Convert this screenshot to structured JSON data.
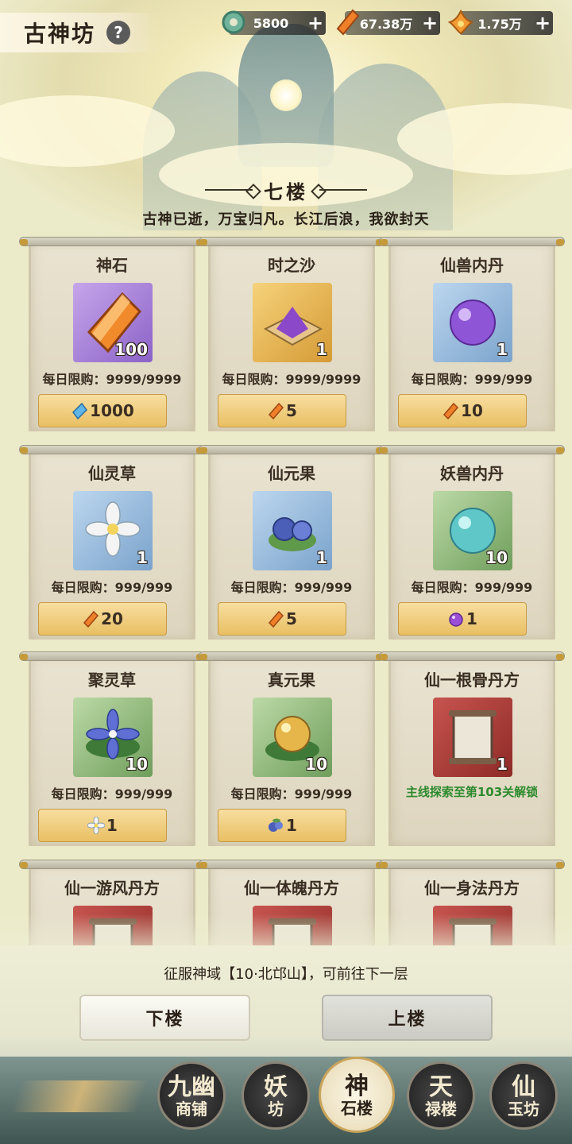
{
  "header": {
    "title": "古神坊",
    "help_icon": "question-mark-icon"
  },
  "resources": [
    {
      "icon": "jade-coin-icon",
      "value": "5800"
    },
    {
      "icon": "orange-crystal-icon",
      "value": "67.38万"
    },
    {
      "icon": "lotus-flame-icon",
      "value": "1.75万"
    }
  ],
  "floor": {
    "name": "七楼",
    "subtitle": "古神已逝，万宝归凡。长江后浪，我欲封天"
  },
  "items": [
    {
      "name": "神石",
      "count": "100",
      "limit": "每日限购：9999/9999",
      "price": "1000",
      "price_icon": "blue-crystal-icon",
      "bg": "purple"
    },
    {
      "name": "时之沙",
      "count": "1",
      "limit": "每日限购：9999/9999",
      "price": "5",
      "price_icon": "orange-crystal-icon",
      "bg": "gold"
    },
    {
      "name": "仙兽内丹",
      "count": "1",
      "limit": "每日限购：999/999",
      "price": "10",
      "price_icon": "orange-crystal-icon",
      "bg": "blue"
    },
    {
      "name": "仙灵草",
      "count": "1",
      "limit": "每日限购：999/999",
      "price": "20",
      "price_icon": "orange-crystal-icon",
      "bg": "blue"
    },
    {
      "name": "仙元果",
      "count": "1",
      "limit": "每日限购：999/999",
      "price": "5",
      "price_icon": "orange-crystal-icon",
      "bg": "blue"
    },
    {
      "name": "妖兽内丹",
      "count": "10",
      "limit": "每日限购：999/999",
      "price": "1",
      "price_icon": "purple-orb-icon",
      "bg": "green"
    },
    {
      "name": "聚灵草",
      "count": "10",
      "limit": "每日限购：999/999",
      "price": "1",
      "price_icon": "white-flower-icon",
      "bg": "green"
    },
    {
      "name": "真元果",
      "count": "10",
      "limit": "每日限购：999/999",
      "price": "1",
      "price_icon": "blue-berry-icon",
      "bg": "green"
    },
    {
      "name": "仙一根骨丹方",
      "count": "1",
      "limit": "主线探索至第103关解锁",
      "price": "",
      "price_icon": "",
      "bg": "red"
    },
    {
      "name": "仙一游风丹方",
      "count": "",
      "limit": "",
      "price": "",
      "price_icon": "",
      "bg": "red"
    },
    {
      "name": "仙一体魄丹方",
      "count": "",
      "limit": "",
      "price": "",
      "price_icon": "",
      "bg": "red"
    },
    {
      "name": "仙一身法丹方",
      "count": "",
      "limit": "",
      "price": "",
      "price_icon": "",
      "bg": "red"
    }
  ],
  "footer": {
    "notice": "征服神域【10·北邙山】，可前往下一层",
    "down_label": "下楼",
    "up_label": "上楼"
  },
  "nav": [
    {
      "big": "九幽",
      "small": "商铺",
      "active": false
    },
    {
      "big": "妖",
      "small": "坊",
      "active": false
    },
    {
      "big": "神",
      "small": "石楼",
      "active": true
    },
    {
      "big": "天",
      "small": "禄楼",
      "active": false
    },
    {
      "big": "仙",
      "small": "玉坊",
      "active": false
    }
  ]
}
